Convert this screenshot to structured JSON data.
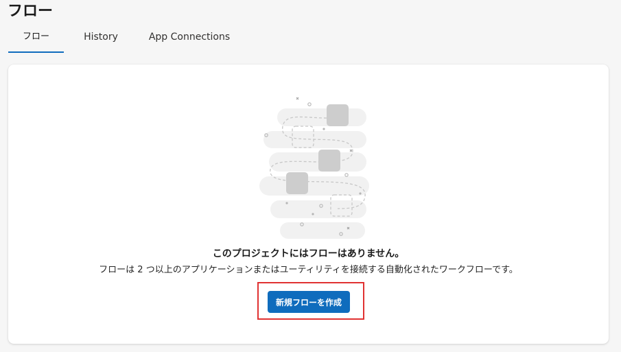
{
  "page": {
    "title": "フロー"
  },
  "tabs": [
    {
      "label": "フロー",
      "active": true
    },
    {
      "label": "History",
      "active": false
    },
    {
      "label": "App Connections",
      "active": false
    }
  ],
  "empty_state": {
    "illustration": "flow-illustration",
    "title": "このプロジェクトにはフローはありません。",
    "description": "フローは 2 つ以上のアプリケーションまたはユーティリティを接続する自動化されたワークフローです。",
    "create_button_label": "新規フローを作成"
  },
  "colors": {
    "accent": "#0f6cbd",
    "highlight": "#e03131",
    "background": "#f6f6f6",
    "card": "#ffffff"
  }
}
